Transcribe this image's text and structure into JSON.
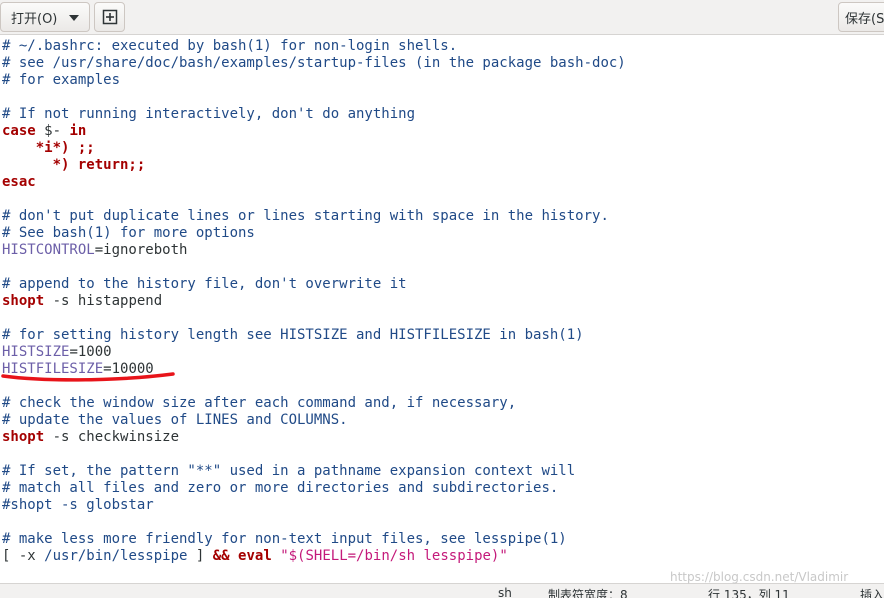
{
  "toolbar": {
    "open_label": "打开(O)",
    "save_label": "保存(S"
  },
  "editor": {
    "lines": [
      {
        "segments": [
          {
            "t": "# ~/.bashrc: executed by bash(1) for non-login shells.",
            "k": "c"
          }
        ]
      },
      {
        "segments": [
          {
            "t": "# see /usr/share/doc/bash/examples/startup-files (in the package bash-doc)",
            "k": "c"
          }
        ]
      },
      {
        "segments": [
          {
            "t": "# for examples",
            "k": "c"
          }
        ]
      },
      {
        "segments": []
      },
      {
        "segments": [
          {
            "t": "# If not running interactively, don't do anything",
            "k": "c"
          }
        ]
      },
      {
        "segments": [
          {
            "t": "case",
            "k": "kw"
          },
          {
            "t": " $- ",
            "k": "p"
          },
          {
            "t": "in",
            "k": "kw"
          }
        ]
      },
      {
        "segments": [
          {
            "t": "    *i*) ;;",
            "k": "kw"
          }
        ]
      },
      {
        "segments": [
          {
            "t": "      *) return;;",
            "k": "kw"
          }
        ]
      },
      {
        "segments": [
          {
            "t": "esac",
            "k": "kw"
          }
        ]
      },
      {
        "segments": []
      },
      {
        "segments": [
          {
            "t": "# don't put duplicate lines or lines starting with space in the history.",
            "k": "c"
          }
        ]
      },
      {
        "segments": [
          {
            "t": "# See bash(1) for more options",
            "k": "c"
          }
        ]
      },
      {
        "segments": [
          {
            "t": "HISTCONTROL",
            "k": "var"
          },
          {
            "t": "=ignoreboth",
            "k": "p"
          }
        ]
      },
      {
        "segments": []
      },
      {
        "segments": [
          {
            "t": "# append to the history file, don't overwrite it",
            "k": "c"
          }
        ]
      },
      {
        "segments": [
          {
            "t": "shopt",
            "k": "kw"
          },
          {
            "t": " -s histappend",
            "k": "p"
          }
        ]
      },
      {
        "segments": []
      },
      {
        "segments": [
          {
            "t": "# for setting history length see HISTSIZE and HISTFILESIZE in bash(1)",
            "k": "c"
          }
        ]
      },
      {
        "segments": [
          {
            "t": "HISTSIZE",
            "k": "var"
          },
          {
            "t": "=1000",
            "k": "p"
          }
        ]
      },
      {
        "segments": [
          {
            "t": "HISTFILESIZE",
            "k": "var"
          },
          {
            "t": "=10000",
            "k": "p"
          }
        ]
      },
      {
        "segments": []
      },
      {
        "segments": [
          {
            "t": "# check the window size after each command and, if necessary,",
            "k": "c"
          }
        ]
      },
      {
        "segments": [
          {
            "t": "# update the values of LINES and COLUMNS.",
            "k": "c"
          }
        ]
      },
      {
        "segments": [
          {
            "t": "shopt",
            "k": "kw"
          },
          {
            "t": " -s checkwinsize",
            "k": "p"
          }
        ]
      },
      {
        "segments": []
      },
      {
        "segments": [
          {
            "t": "# If set, the pattern \"**\" used in a pathname expansion context will",
            "k": "c"
          }
        ]
      },
      {
        "segments": [
          {
            "t": "# match all files and zero or more directories and subdirectories.",
            "k": "c"
          }
        ]
      },
      {
        "segments": [
          {
            "t": "#shopt -s globstar",
            "k": "c"
          }
        ]
      },
      {
        "segments": []
      },
      {
        "segments": [
          {
            "t": "# make less more friendly for non-text input files, see lesspipe(1)",
            "k": "c"
          }
        ]
      },
      {
        "segments": [
          {
            "t": "[ -x ",
            "k": "p"
          },
          {
            "t": "/usr/bin/lesspipe",
            "k": "c"
          },
          {
            "t": " ] ",
            "k": "p"
          },
          {
            "t": "&&",
            "k": "kw"
          },
          {
            "t": " ",
            "k": "p"
          },
          {
            "t": "eval",
            "k": "kw"
          },
          {
            "t": " ",
            "k": "p"
          },
          {
            "t": "\"$(SHELL=/bin/sh lesspipe)\"",
            "k": "str"
          }
        ]
      }
    ]
  },
  "statusbar": {
    "language": "sh",
    "tab_width": "制表符宽度：8",
    "position": "行 135，列 11",
    "mode": "插入"
  },
  "watermark": "https://blog.csdn.net/Vladimir"
}
